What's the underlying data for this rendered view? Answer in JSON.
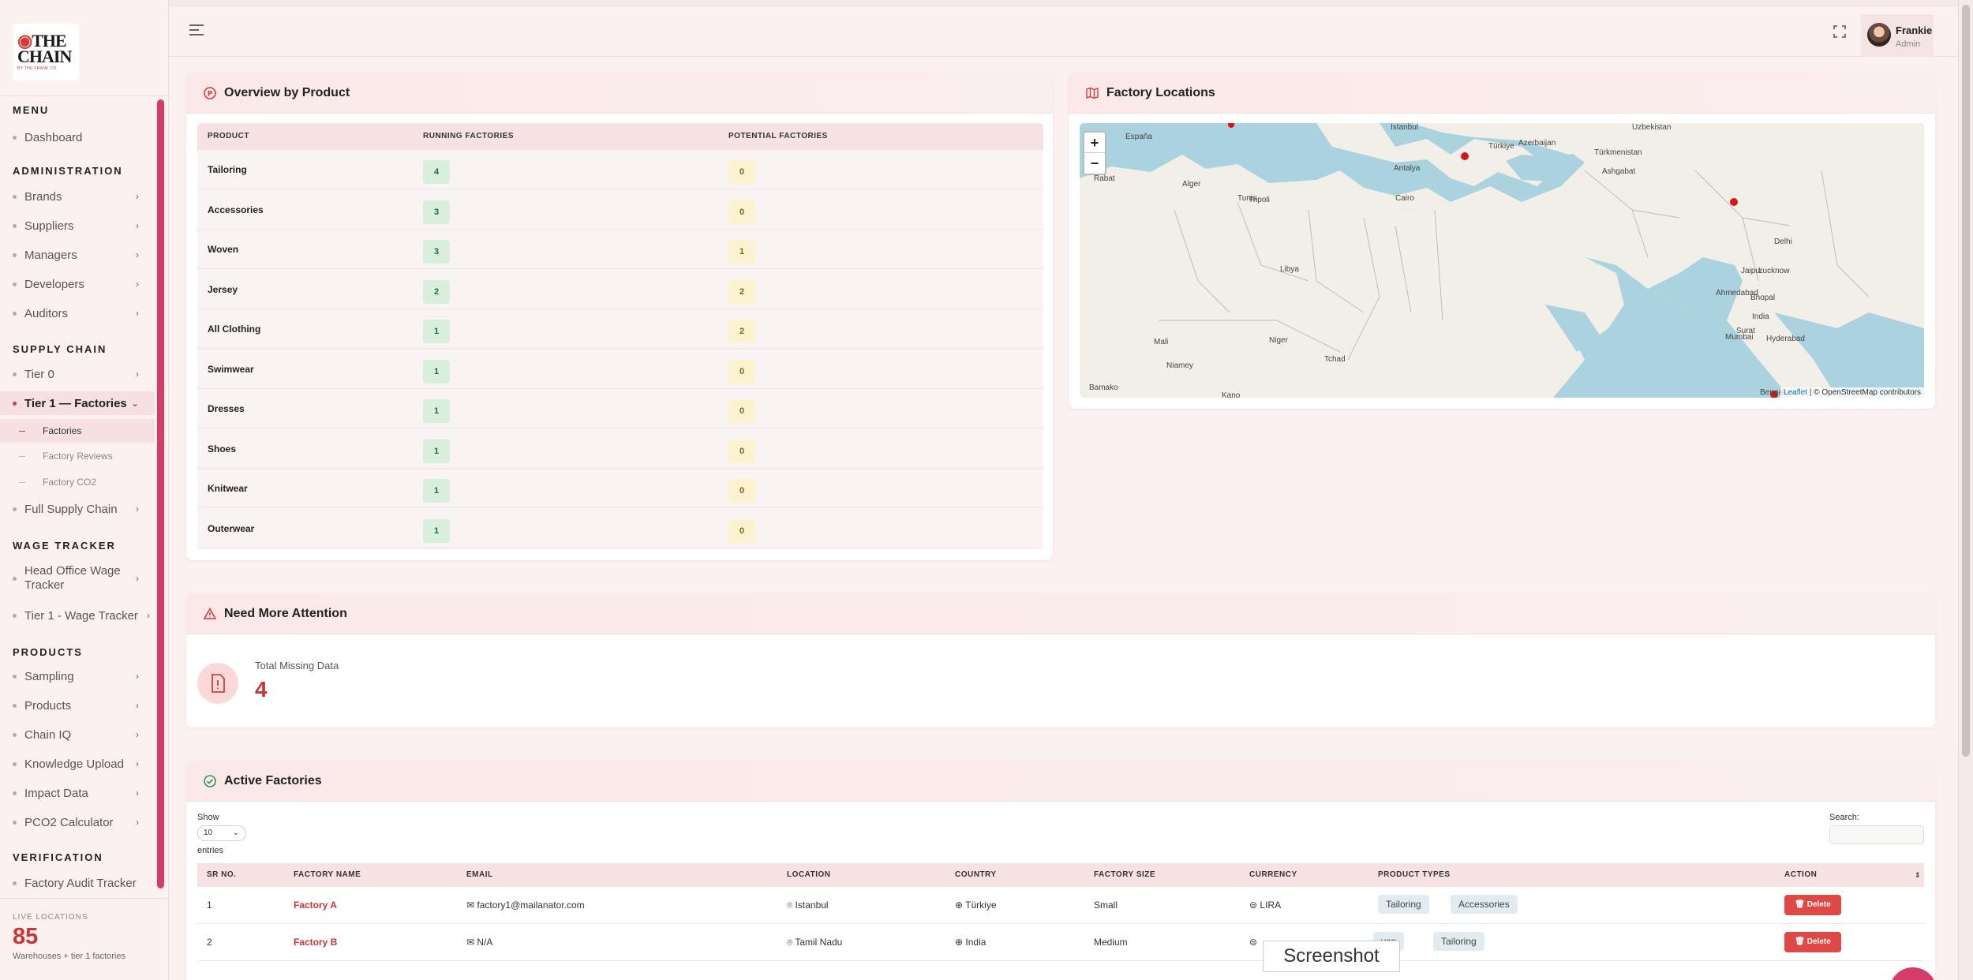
{
  "brand": {
    "logo_line1": "THE",
    "logo_line2": "CHAIN",
    "logo_tagline": "BY THE FRANK CO"
  },
  "sidebar": {
    "sections": {
      "menu": "MENU",
      "administration": "ADMINISTRATION",
      "supply_chain": "SUPPLY CHAIN",
      "wage_tracker": "WAGE TRACKER",
      "products": "PRODUCTS",
      "verification": "VERIFICATION"
    },
    "items": {
      "dashboard": "Dashboard",
      "brands": "Brands",
      "suppliers": "Suppliers",
      "managers": "Managers",
      "developers": "Developers",
      "auditors": "Auditors",
      "tier0": "Tier 0",
      "tier1": "Tier 1 — Factories",
      "factories": "Factories",
      "factory_reviews": "Factory Reviews",
      "factory_co2": "Factory CO2",
      "full_supply_chain": "Full Supply Chain",
      "head_office_wage_1": "Head Office Wage",
      "head_office_wage_2": "Tracker",
      "tier1_wage": "Tier 1 - Wage Tracker",
      "sampling": "Sampling",
      "products": "Products",
      "chain_iq": "Chain IQ",
      "knowledge_upload": "Knowledge Upload",
      "impact_data": "Impact Data",
      "pco2": "PCO2 Calculator",
      "factory_audit": "Factory Audit Tracker"
    },
    "live": {
      "label": "LIVE LOCATIONS",
      "value": "85",
      "sub": "Warehouses + tier 1 factories"
    }
  },
  "header": {
    "user_name": "Frankie",
    "user_role": "Admin"
  },
  "overview": {
    "title": "Overview by Product",
    "columns": [
      "PRODUCT",
      "RUNNING FACTORIES",
      "POTENTIAL FACTORIES"
    ],
    "rows": [
      {
        "product": "Tailoring",
        "running": "4",
        "potential": "0"
      },
      {
        "product": "Accessories",
        "running": "3",
        "potential": "0"
      },
      {
        "product": "Woven",
        "running": "3",
        "potential": "1"
      },
      {
        "product": "Jersey",
        "running": "2",
        "potential": "2"
      },
      {
        "product": "All Clothing",
        "running": "1",
        "potential": "2"
      },
      {
        "product": "Swimwear",
        "running": "1",
        "potential": "0"
      },
      {
        "product": "Dresses",
        "running": "1",
        "potential": "0"
      },
      {
        "product": "Shoes",
        "running": "1",
        "potential": "0"
      },
      {
        "product": "Knitwear",
        "running": "1",
        "potential": "0"
      },
      {
        "product": "Outerwear",
        "running": "1",
        "potential": "0"
      }
    ]
  },
  "map": {
    "title": "Factory Locations",
    "zoom_in": "+",
    "zoom_out": "−",
    "attribution_link": "Leaflet",
    "attribution_text": " | © OpenStreetMap contributors",
    "labels": [
      "España",
      "Rabat",
      "Alger",
      "Tunis",
      "Türkiye",
      "Istanbul",
      "Antalya",
      "Azerbaijan",
      "Türkmenistan",
      "Uzbekistan",
      "Ashgabat",
      "Tripoli",
      "Libya",
      "Niger",
      "Mali",
      "Tchad",
      "Niamey",
      "Bamako",
      "Kano",
      "Cairo",
      "Delhi",
      "Lucknow",
      "Jaipur",
      "Ahmedabad",
      "Surat",
      "Bhopal",
      "India",
      "Mumbai",
      "Hyderabad",
      "Bengaluru"
    ]
  },
  "attention": {
    "title": "Need More Attention",
    "label": "Total Missing Data",
    "value": "4"
  },
  "active": {
    "title": "Active Factories",
    "show": "Show",
    "page_size": "10",
    "entries": "entries",
    "search_label": "Search:",
    "columns": [
      "SR NO.",
      "FACTORY NAME",
      "EMAIL",
      "LOCATION",
      "COUNTRY",
      "FACTORY SIZE",
      "CURRENCY",
      "PRODUCT TYPES",
      "ACTION"
    ],
    "rows": [
      {
        "sr": "1",
        "name": "Factory A",
        "email": "factory1@mailanator.com",
        "location": "Istanbul",
        "country": "Türkiye",
        "size": "Small",
        "currency": "LIRA",
        "types": [
          "Tailoring",
          "Accessories"
        ],
        "action": "Delete"
      },
      {
        "sr": "2",
        "name": "Factory B",
        "email": "N/A",
        "location": "Tamil Nadu",
        "country": "India",
        "size": "Medium",
        "currency": "",
        "types": [
          "ven",
          "Tailoring"
        ],
        "action": "Delete"
      }
    ]
  },
  "tooltip": "Screenshot"
}
